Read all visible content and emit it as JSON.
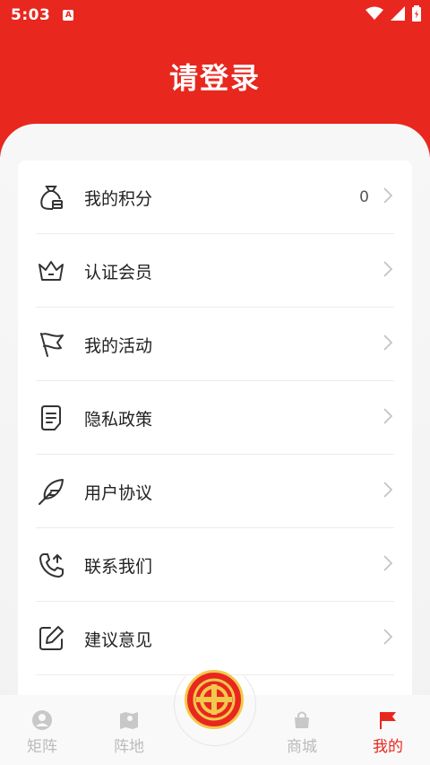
{
  "status": {
    "time": "5:03",
    "indicator": "A"
  },
  "header": {
    "title": "请登录"
  },
  "menu": [
    {
      "label": "我的积分",
      "value": "0",
      "icon": "money-bag-icon"
    },
    {
      "label": "认证会员",
      "icon": "crown-icon"
    },
    {
      "label": "我的活动",
      "icon": "flag-icon"
    },
    {
      "label": "隐私政策",
      "icon": "document-icon"
    },
    {
      "label": "用户协议",
      "icon": "feather-icon"
    },
    {
      "label": "联系我们",
      "icon": "phone-icon"
    },
    {
      "label": "建议意见",
      "icon": "edit-icon"
    }
  ],
  "tabs": [
    {
      "label": "矩阵",
      "icon": "user-icon",
      "active": false
    },
    {
      "label": "阵地",
      "icon": "map-icon",
      "active": false
    },
    {
      "label": "商城",
      "icon": "shop-bag-icon",
      "active": false
    },
    {
      "label": "我的",
      "icon": "red-flag-icon",
      "active": true
    }
  ],
  "colors": {
    "accent": "#e8271f",
    "inactive_tab": "#bbbbbb",
    "badge_gold": "#f2c94c"
  }
}
